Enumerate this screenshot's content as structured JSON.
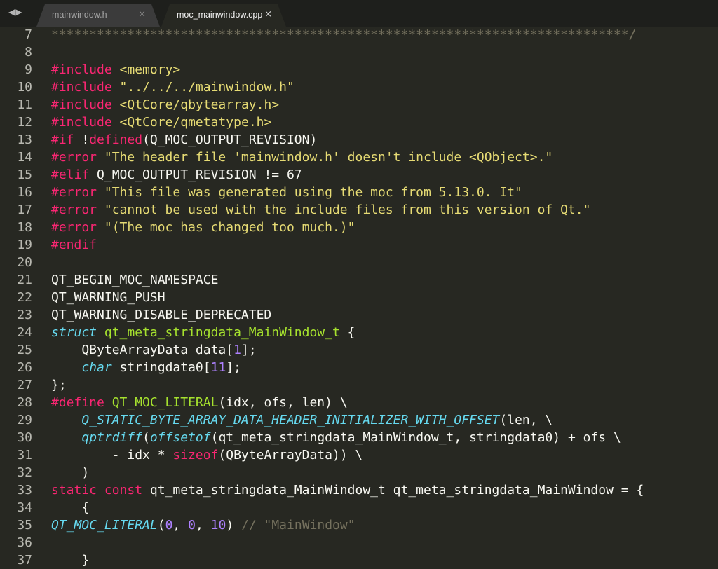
{
  "colors": {
    "background": "#272822",
    "tabbar": "#1e1f1c",
    "keyword": "#f92672",
    "string": "#e6db74",
    "type": "#66d9ef",
    "function": "#a6e22e",
    "number": "#ae81ff",
    "comment": "#75715e",
    "default": "#f8f8f2"
  },
  "nav": {
    "icons": [
      "chevron-left-icon",
      "chevron-right-icon"
    ],
    "label": "◀▶"
  },
  "tabs": [
    {
      "label": "mainwindow.h",
      "close": "×",
      "active": false
    },
    {
      "label": "moc_mainwindow.cpp",
      "close": "×",
      "active": true
    }
  ],
  "editor": {
    "lines": [
      {
        "n": "7",
        "tokens": [
          [
            "cm",
            "****************************************************************************/"
          ]
        ]
      },
      {
        "n": "8",
        "tokens": []
      },
      {
        "n": "9",
        "tokens": [
          [
            "kw",
            "#include "
          ],
          [
            "str",
            "<memory>"
          ]
        ]
      },
      {
        "n": "10",
        "tokens": [
          [
            "kw",
            "#include "
          ],
          [
            "str",
            "\"../../../mainwindow.h\""
          ]
        ]
      },
      {
        "n": "11",
        "tokens": [
          [
            "kw",
            "#include "
          ],
          [
            "str",
            "<QtCore/qbytearray.h>"
          ]
        ]
      },
      {
        "n": "12",
        "tokens": [
          [
            "kw",
            "#include "
          ],
          [
            "str",
            "<QtCore/qmetatype.h>"
          ]
        ]
      },
      {
        "n": "13",
        "tokens": [
          [
            "kw",
            "#if "
          ],
          [
            "df",
            "!"
          ],
          [
            "kw",
            "defined"
          ],
          [
            "df",
            "(Q_MOC_OUTPUT_REVISION)"
          ]
        ]
      },
      {
        "n": "14",
        "tokens": [
          [
            "kw",
            "#error "
          ],
          [
            "str",
            "\"The header file 'mainwindow.h' doesn't include <QObject>.\""
          ]
        ]
      },
      {
        "n": "15",
        "tokens": [
          [
            "kw",
            "#elif "
          ],
          [
            "df",
            "Q_MOC_OUTPUT_REVISION != 67"
          ]
        ]
      },
      {
        "n": "16",
        "tokens": [
          [
            "kw",
            "#error "
          ],
          [
            "str",
            "\"This file was generated using the moc from 5.13.0. It\""
          ]
        ]
      },
      {
        "n": "17",
        "tokens": [
          [
            "kw",
            "#error "
          ],
          [
            "str",
            "\"cannot be used with the include files from this version of Qt.\""
          ]
        ]
      },
      {
        "n": "18",
        "tokens": [
          [
            "kw",
            "#error "
          ],
          [
            "str",
            "\"(The moc has changed too much.)\""
          ]
        ]
      },
      {
        "n": "19",
        "tokens": [
          [
            "kw",
            "#endif"
          ]
        ]
      },
      {
        "n": "20",
        "tokens": []
      },
      {
        "n": "21",
        "tokens": [
          [
            "df",
            "QT_BEGIN_MOC_NAMESPACE"
          ]
        ]
      },
      {
        "n": "22",
        "tokens": [
          [
            "df",
            "QT_WARNING_PUSH"
          ]
        ]
      },
      {
        "n": "23",
        "tokens": [
          [
            "df",
            "QT_WARNING_DISABLE_DEPRECATED"
          ]
        ]
      },
      {
        "n": "24",
        "tokens": [
          [
            "ty",
            "struct "
          ],
          [
            "fn",
            "qt_meta_stringdata_MainWindow_t"
          ],
          [
            "df",
            " {"
          ]
        ]
      },
      {
        "n": "25",
        "tokens": [
          [
            "df",
            "    QByteArrayData data["
          ],
          [
            "num",
            "1"
          ],
          [
            "df",
            "];"
          ]
        ]
      },
      {
        "n": "26",
        "tokens": [
          [
            "df",
            "    "
          ],
          [
            "ty",
            "char"
          ],
          [
            "df",
            " stringdata0["
          ],
          [
            "num",
            "11"
          ],
          [
            "df",
            "];"
          ]
        ]
      },
      {
        "n": "27",
        "tokens": [
          [
            "df",
            "};"
          ]
        ]
      },
      {
        "n": "28",
        "tokens": [
          [
            "kw",
            "#define "
          ],
          [
            "fn",
            "QT_MOC_LITERAL"
          ],
          [
            "df",
            "(idx, ofs, len) \\"
          ]
        ]
      },
      {
        "n": "29",
        "tokens": [
          [
            "df",
            "    "
          ],
          [
            "ty",
            "Q_STATIC_BYTE_ARRAY_DATA_HEADER_INITIALIZER_WITH_OFFSET"
          ],
          [
            "df",
            "(len, \\"
          ]
        ]
      },
      {
        "n": "30",
        "tokens": [
          [
            "df",
            "    "
          ],
          [
            "ty",
            "qptrdiff"
          ],
          [
            "df",
            "("
          ],
          [
            "ty",
            "offsetof"
          ],
          [
            "df",
            "(qt_meta_stringdata_MainWindow_t, stringdata0) + ofs \\"
          ]
        ]
      },
      {
        "n": "31",
        "tokens": [
          [
            "df",
            "        - idx * "
          ],
          [
            "kw",
            "sizeof"
          ],
          [
            "df",
            "(QByteArrayData)) \\"
          ]
        ]
      },
      {
        "n": "32",
        "tokens": [
          [
            "df",
            "    )"
          ]
        ]
      },
      {
        "n": "33",
        "tokens": [
          [
            "kw",
            "static const"
          ],
          [
            "df",
            " qt_meta_stringdata_MainWindow_t qt_meta_stringdata_MainWindow = {"
          ]
        ]
      },
      {
        "n": "34",
        "tokens": [
          [
            "df",
            "    {"
          ]
        ]
      },
      {
        "n": "35",
        "tokens": [
          [
            "ty",
            "QT_MOC_LITERAL"
          ],
          [
            "df",
            "("
          ],
          [
            "num",
            "0"
          ],
          [
            "df",
            ", "
          ],
          [
            "num",
            "0"
          ],
          [
            "df",
            ", "
          ],
          [
            "num",
            "10"
          ],
          [
            "df",
            ") "
          ],
          [
            "cm",
            "// \"MainWindow\""
          ]
        ]
      },
      {
        "n": "36",
        "tokens": []
      },
      {
        "n": "37",
        "tokens": [
          [
            "df",
            "    }"
          ]
        ]
      }
    ]
  }
}
